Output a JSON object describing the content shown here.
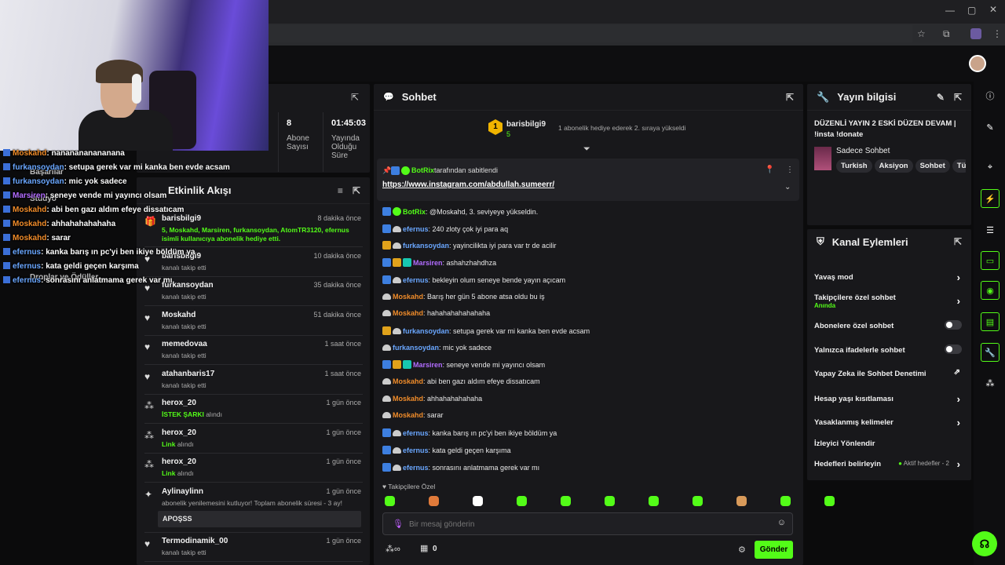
{
  "browser": {
    "icons": [
      "minimize-icon",
      "maximize-icon",
      "close-icon",
      "star-icon",
      "extensions-icon",
      "profile-icon",
      "more-icon"
    ]
  },
  "overlay_chat": [
    {
      "user": "Moskahd",
      "color": "#f08c2a",
      "text": ": nananananananana"
    },
    {
      "user": "furkansoydan",
      "color": "#6aa7ff",
      "text": ": setupa gerek var mi kanka ben evde acsam"
    },
    {
      "user": "furkansoydan",
      "color": "#6aa7ff",
      "text": ": mic yok sadece"
    },
    {
      "user": "Marsiren",
      "color": "#b26cff",
      "text": ": seneye vende mi yayıncı olsam"
    },
    {
      "user": "Moskahd",
      "color": "#f08c2a",
      "text": ": abi ben gazı aldım efeye dissatıcam"
    },
    {
      "user": "Moskahd",
      "color": "#f08c2a",
      "text": ": ahhahahahahaha"
    },
    {
      "user": "Moskahd",
      "color": "#f08c2a",
      "text": ": sarar"
    },
    {
      "user": "efernus",
      "color": "#6aa7ff",
      "text": ": kanka barış ın pc'yi ben ikiye böldüm ya"
    },
    {
      "user": "efernus",
      "color": "#6aa7ff",
      "text": ": kata geldi geçen karşıma"
    },
    {
      "user": "efernus",
      "color": "#6aa7ff",
      "text": ": sonrasını anlatmama gerek var mı"
    }
  ],
  "overlay_menu": [
    "Başarılar",
    "Stüdyo",
    "Droplar ve Ödüller"
  ],
  "stats": {
    "subs_value": "8",
    "subs_label": "Abone Sayısı",
    "time_value": "01:45:03",
    "time_label": "Yayında Olduğu Süre"
  },
  "activity": {
    "title": "Etkinlik Akışı",
    "items": [
      {
        "name": "barisbilgi9",
        "time": "8 dakika önce",
        "sub": "5, Moskahd, Marsiren, furkansoydan, AtomTR3120, efernus isimli kullanıcıya abonelik hediye etti.",
        "icon": "gift-icon"
      },
      {
        "name": "barisbilgi9",
        "time": "10 dakika önce",
        "sub": "kanalı takip etti",
        "icon": "heart-icon"
      },
      {
        "name": "furkansoydan",
        "time": "35 dakika önce",
        "sub": "kanalı takip etti",
        "icon": "heart-icon"
      },
      {
        "name": "Moskahd",
        "time": "51 dakika önce",
        "sub": "kanalı takip etti",
        "icon": "heart-icon"
      },
      {
        "name": "memedovaa",
        "time": "1 saat önce",
        "sub": "kanalı takip etti",
        "icon": "heart-icon"
      },
      {
        "name": "atahanbaris17",
        "time": "1 saat önce",
        "sub": "kanalı takip etti",
        "icon": "heart-icon"
      },
      {
        "name": "herox_20",
        "time": "1 gün önce",
        "sub_em": "İSTEK ŞARKI",
        "sub": " alındı",
        "icon": "points-icon"
      },
      {
        "name": "herox_20",
        "time": "1 gün önce",
        "sub_em": "Link",
        "sub": " alındı",
        "icon": "points-icon"
      },
      {
        "name": "herox_20",
        "time": "1 gün önce",
        "sub_em": "Link",
        "sub": " alındı",
        "icon": "points-icon"
      },
      {
        "name": "Aylinaylinn",
        "time": "1 gün önce",
        "sub": "abonelik yenilemesini kutluyor! Toplam abonelik süresi - 3 ay!",
        "icon": "star-icon"
      },
      {
        "name": "Termodinamik_00",
        "time": "1 gün önce",
        "sub": "kanalı takip etti",
        "icon": "heart-icon"
      }
    ],
    "resub_message": "APOŞSS"
  },
  "chat": {
    "title": "Sohbet",
    "top_gifter": {
      "rank": "1",
      "name": "barisbilgi9",
      "count": "5",
      "note": "1 abonelik hediye ederek 2. sıraya yükseldi"
    },
    "pinned": {
      "by": "BotRix",
      "by_suffix": "tarafından sabitlendi",
      "link": "https://www.instagram.com/abdullah.sumeerr/"
    },
    "messages": [
      {
        "badges": [
          "blue",
          "green"
        ],
        "user": "BotRix",
        "color": "#53fc18",
        "text": ": @Moskahd, 3. seviyeye yükseldin."
      },
      {
        "badges": [
          "blue",
          "cloud"
        ],
        "user": "efernus",
        "color": "#6aa7ff",
        "text": ": 240 zloty çok iyi para aq"
      },
      {
        "badges": [
          "gold",
          "cloud"
        ],
        "user": "furkansoydan",
        "color": "#6aa7ff",
        "text": ": yayincilikta iyi para var tr de acilir"
      },
      {
        "badges": [
          "blue",
          "gold",
          "teal"
        ],
        "user": "Marsiren",
        "color": "#b26cff",
        "text": ": ashahzhahdhza"
      },
      {
        "badges": [
          "blue",
          "cloud"
        ],
        "user": "efernus",
        "color": "#6aa7ff",
        "text": ": bekleyin olum seneye bende yayın açıcam"
      },
      {
        "badges": [
          "cloud"
        ],
        "user": "Moskahd",
        "color": "#f08c2a",
        "text": ": Barış her gün 5 abone atsa oldu bu iş"
      },
      {
        "badges": [
          "cloud"
        ],
        "user": "Moskahd",
        "color": "#f08c2a",
        "text": ": hahahahahahahaha"
      },
      {
        "badges": [
          "gold",
          "cloud"
        ],
        "user": "furkansoydan",
        "color": "#6aa7ff",
        "text": ": setupa gerek var mi kanka ben evde acsam"
      },
      {
        "badges": [
          "cloud"
        ],
        "user": "furkansoydan",
        "color": "#6aa7ff",
        "text": ": mic yok sadece"
      },
      {
        "badges": [
          "blue",
          "gold",
          "teal"
        ],
        "user": "Marsiren",
        "color": "#b26cff",
        "text": ": seneye vende mi yayıncı olsam"
      },
      {
        "badges": [
          "cloud"
        ],
        "user": "Moskahd",
        "color": "#f08c2a",
        "text": ": abi ben gazı aldım efeye dissatıcam"
      },
      {
        "badges": [
          "cloud"
        ],
        "user": "Moskahd",
        "color": "#f08c2a",
        "text": ": ahhahahahahaha"
      },
      {
        "badges": [
          "cloud"
        ],
        "user": "Moskahd",
        "color": "#f08c2a",
        "text": ": sarar"
      },
      {
        "badges": [
          "blue",
          "cloud"
        ],
        "user": "efernus",
        "color": "#6aa7ff",
        "text": ": kanka barış ın pc'yi ben ikiye böldüm ya"
      },
      {
        "badges": [
          "blue",
          "cloud"
        ],
        "user": "efernus",
        "color": "#6aa7ff",
        "text": ": kata geldi geçen karşıma"
      },
      {
        "badges": [
          "blue",
          "cloud"
        ],
        "user": "efernus",
        "color": "#6aa7ff",
        "text": ": sonrasını anlatmama gerek var mı"
      }
    ],
    "followers_only": "Takipçilere Özel",
    "input_placeholder": "Bir mesaj gönderin",
    "points": "0",
    "send_label": "Gönder",
    "emotes": [
      "#53fc18",
      "#e07a3a",
      "#ffffff",
      "#53fc18",
      "#53fc18",
      "#53fc18",
      "#53fc18",
      "#53fc18",
      "#d89a5a",
      "#53fc18",
      "#53fc18"
    ]
  },
  "stream_info": {
    "title": "Yayın bilgisi",
    "stream_title": "DÜZENLİ YAYIN 2 ESKİ DÜZEN DEVAM | !insta !donate",
    "category": "Sadece Sohbet",
    "tags": [
      "Turkish",
      "Aksiyon",
      "Sohbet",
      "Tü"
    ]
  },
  "channel_actions": {
    "title": "Kanal Eylemleri",
    "rows": [
      {
        "label": "Yavaş mod",
        "kind": "chev"
      },
      {
        "label": "Takipçilere özel sohbet",
        "sub": "Anında",
        "kind": "chev"
      },
      {
        "label": "Abonelere özel sohbet",
        "kind": "toggle"
      },
      {
        "label": "Yalnızca ifadelerle sohbet",
        "kind": "toggle"
      },
      {
        "label": "Yapay Zeka ile Sohbet Denetimi",
        "kind": "ext"
      },
      {
        "label": "Hesap yaşı kısıtlaması",
        "kind": "chev"
      },
      {
        "label": "Yasaklanmış kelimeler",
        "kind": "chev"
      },
      {
        "label": "İzleyici Yönlendir",
        "kind": "none"
      },
      {
        "label": "Hedefleri belirleyin",
        "right": "Aktif hedefler - 2",
        "kind": "chev"
      }
    ]
  },
  "colors": {
    "accent": "#53fc18",
    "panel": "#18181b",
    "bg": "#0b0b0c"
  }
}
